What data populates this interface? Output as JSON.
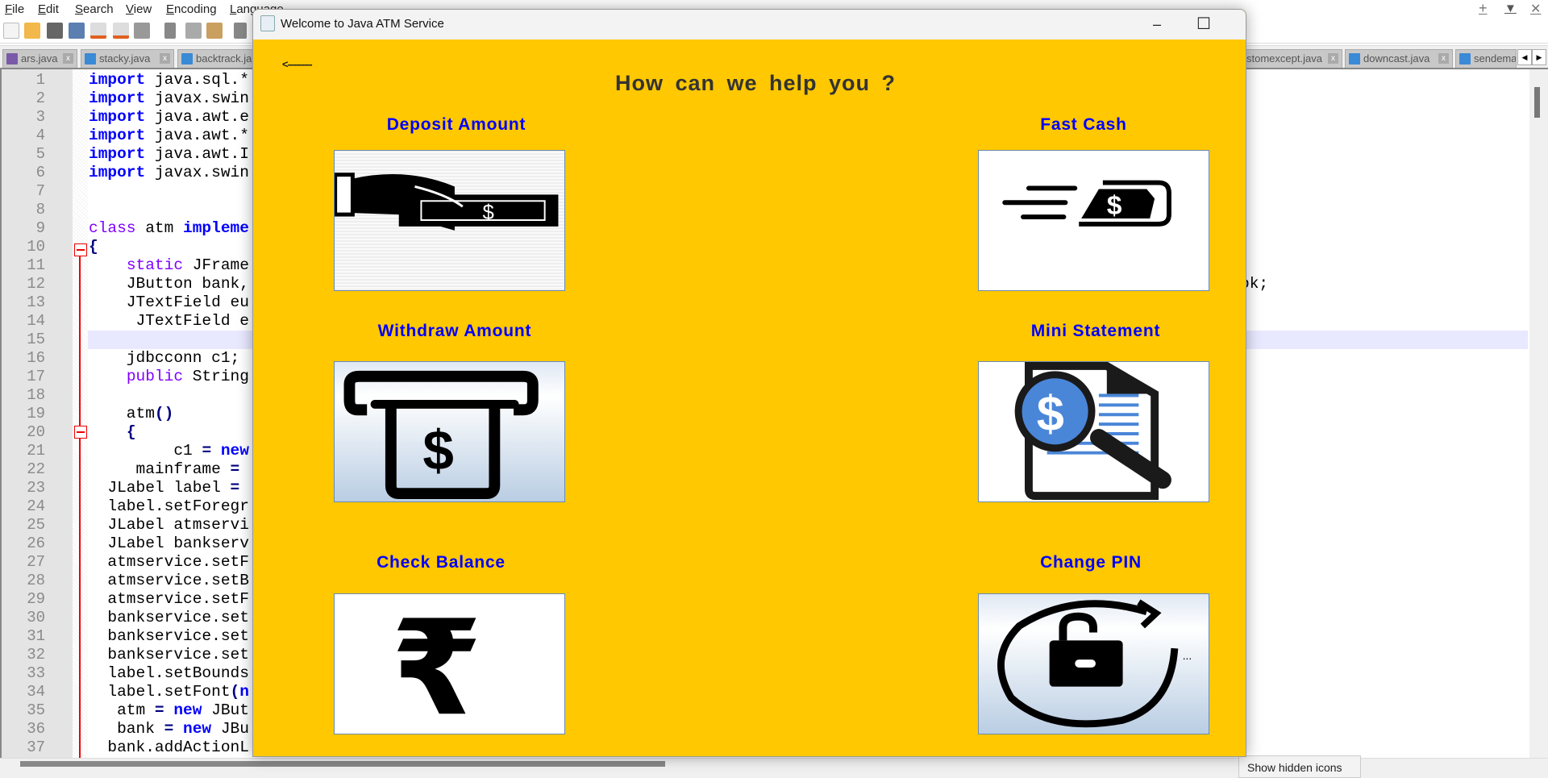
{
  "editor": {
    "menu": [
      "File",
      "Edit",
      "Search",
      "View",
      "Encoding",
      "Language"
    ],
    "tabs_left": [
      "ars.java",
      "stacky.java",
      "backtrack.ja"
    ],
    "tabs_right": [
      "stomexcept.java",
      "downcast.java",
      "sendema"
    ],
    "tab_close": "x",
    "window_controls": {
      "new": "+",
      "dropdown": "▼",
      "close": "✕"
    },
    "tab_scroll": {
      "left": "◀",
      "right": "▶"
    },
    "lines": [
      [
        [
          "import",
          "kw"
        ],
        [
          " java.sql.*",
          ""
        ]
      ],
      [
        [
          "import",
          "kw"
        ],
        [
          " javax.swin",
          ""
        ]
      ],
      [
        [
          "import",
          "kw"
        ],
        [
          " java.awt.e",
          ""
        ]
      ],
      [
        [
          "import",
          "kw"
        ],
        [
          " java.awt.*",
          ""
        ]
      ],
      [
        [
          "import",
          "kw"
        ],
        [
          " java.awt.I",
          ""
        ]
      ],
      [
        [
          "import",
          "kw"
        ],
        [
          " javax.swin",
          ""
        ]
      ],
      [],
      [],
      [
        [
          "class",
          "kp"
        ],
        [
          " atm ",
          ""
        ],
        [
          "impleme",
          "kw"
        ]
      ],
      [
        [
          "{",
          "op"
        ]
      ],
      [
        [
          "    ",
          ""
        ],
        [
          "static",
          "kp"
        ],
        [
          " JFrame",
          ""
        ]
      ],
      [
        [
          "    JButton bank,",
          ""
        ]
      ],
      [
        [
          "    JTextField eu",
          ""
        ]
      ],
      [
        [
          "     JTextField e",
          ""
        ]
      ],
      [],
      [
        [
          "    jdbcconn c1;",
          ""
        ]
      ],
      [
        [
          "    ",
          ""
        ],
        [
          "public",
          "kp"
        ],
        [
          " String",
          ""
        ]
      ],
      [],
      [
        [
          "    atm",
          ""
        ],
        [
          "()",
          "op"
        ]
      ],
      [
        [
          "    ",
          ""
        ],
        [
          "{",
          "op"
        ]
      ],
      [
        [
          "         c1 ",
          ""
        ],
        [
          "=",
          "op"
        ],
        [
          " ",
          ""
        ],
        [
          "new",
          "kw"
        ]
      ],
      [
        [
          "     mainframe ",
          ""
        ],
        [
          "=",
          "op"
        ]
      ],
      [
        [
          "  JLabel label ",
          ""
        ],
        [
          "=",
          "op"
        ]
      ],
      [
        [
          "  label.setForegr",
          ""
        ]
      ],
      [
        [
          "  JLabel atmservi",
          ""
        ]
      ],
      [
        [
          "  JLabel bankserv",
          ""
        ]
      ],
      [
        [
          "  atmservice.setF",
          ""
        ]
      ],
      [
        [
          "  atmservice.setB",
          ""
        ]
      ],
      [
        [
          "  atmservice.setF",
          ""
        ]
      ],
      [
        [
          "  bankservice.set",
          ""
        ]
      ],
      [
        [
          "  bankservice.set",
          ""
        ]
      ],
      [
        [
          "  bankservice.set",
          ""
        ]
      ],
      [
        [
          "  label.setBounds",
          ""
        ]
      ],
      [
        [
          "  label.setFont",
          ""
        ],
        [
          "(",
          "op"
        ],
        [
          "n",
          "kw"
        ]
      ],
      [
        [
          "   atm ",
          ""
        ],
        [
          "=",
          "op"
        ],
        [
          " ",
          ""
        ],
        [
          "new",
          "kw"
        ],
        [
          " JBut",
          ""
        ]
      ],
      [
        [
          "   bank ",
          ""
        ],
        [
          "=",
          "op"
        ],
        [
          " ",
          ""
        ],
        [
          "new",
          "kw"
        ],
        [
          " JBu",
          ""
        ]
      ],
      [
        [
          "  bank.addActionL",
          ""
        ]
      ]
    ],
    "line12_tail": "ok;",
    "tooltip": "Show hidden icons"
  },
  "atm": {
    "title": "Welcome to Java ATM Service",
    "controls": {
      "minimize": "–",
      "maximize": "☐",
      "close": "✕"
    },
    "back": "<---------",
    "heading": "How can we help you ?",
    "options": [
      {
        "label": "Deposit Amount",
        "icon": "hand-cash-icon"
      },
      {
        "label": "Fast Cash",
        "icon": "fast-cash-icon"
      },
      {
        "label": "Withdraw Amount",
        "icon": "atm-withdraw-icon"
      },
      {
        "label": "Mini Statement",
        "icon": "statement-search-icon"
      },
      {
        "label": "Check Balance",
        "icon": "rupee-icon"
      },
      {
        "label": "Change PIN",
        "icon": "lock-refresh-icon"
      }
    ],
    "glyphs": {
      "dollar": "$",
      "rupee": "₹",
      "ellipsis": "..."
    },
    "colors": {
      "background": "#ffc800",
      "label": "#0000ff",
      "heading": "#333333"
    }
  }
}
